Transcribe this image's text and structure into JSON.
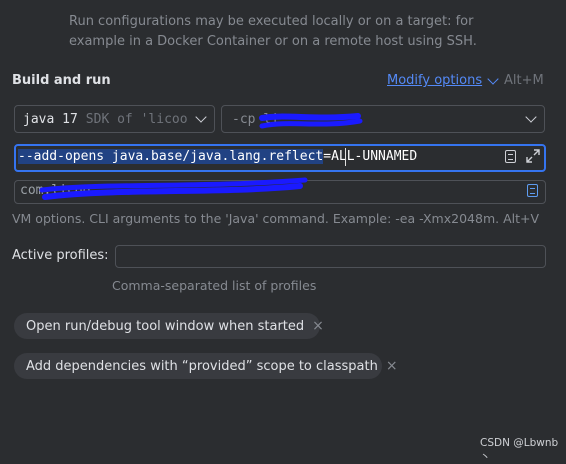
{
  "help_text": "Run configurations may be executed locally or on a target: for example in a Docker Container or on a remote host using SSH.",
  "section": {
    "title": "Build and run",
    "modify_options_label": "Modify options",
    "modify_options_shortcut": "Alt+M"
  },
  "jdk_select": {
    "version": "java 17",
    "description": "SDK of 'licoo"
  },
  "classpath_select": {
    "value": "-cp li"
  },
  "vm_options": {
    "value_selected": "--add-opens java.base/java.lang.reflect",
    "value_rest": "=ALL-UNNAMED",
    "hint": "VM options. CLI arguments to the 'Java' command. Example: -ea -Xmx2048m. Alt+V"
  },
  "program_field": {
    "value": "com.licoo."
  },
  "active_profiles": {
    "label": "Active profiles:",
    "value": "",
    "hint": "Comma-separated list of profiles"
  },
  "chips": [
    {
      "label": "Open run/debug tool window when started"
    },
    {
      "label": "Add dependencies with “provided” scope to classpath"
    }
  ],
  "watermark": "CSDN @Lbwnb丶",
  "colors": {
    "background": "#2b2d30",
    "accent": "#3574f0",
    "link": "#548af7",
    "redaction": "#1a1aff"
  }
}
